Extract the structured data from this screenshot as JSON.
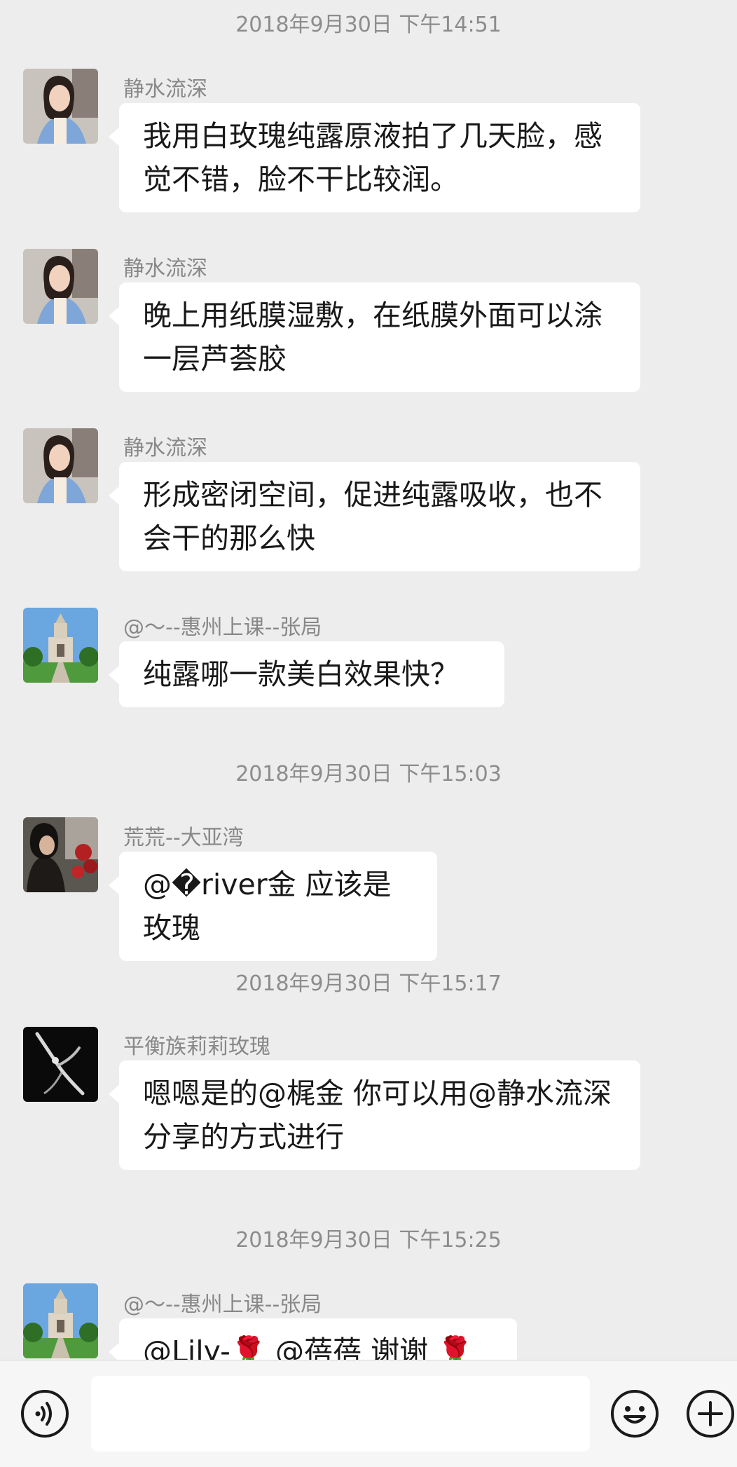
{
  "timestamps": [
    "2018年9月30日 下午14:51",
    "2018年9月30日 下午15:03",
    "2018年9月30日 下午15:17",
    "2018年9月30日 下午15:25"
  ],
  "messages": [
    {
      "sender": "静水流深",
      "text": "我用白玫瑰纯露原液拍了几天脸，感觉不错，脸不干比较润。",
      "avatar": "woman-portrait-avatar"
    },
    {
      "sender": "静水流深",
      "text": "晚上用纸膜湿敷，在纸膜外面可以涂一层芦荟胶",
      "avatar": "woman-portrait-avatar"
    },
    {
      "sender": "静水流深",
      "text": "形成密闭空间，促进纯露吸收，也不会干的那么快",
      "avatar": "woman-portrait-avatar"
    },
    {
      "sender": "@～--惠州上课--张局",
      "text": "纯露哪一款美白效果快？",
      "avatar": "building-avatar"
    },
    {
      "sender": "荒荒--大亚湾",
      "text": "@�river金  应该是玫瑰",
      "avatar": "woman-roses-avatar"
    },
    {
      "sender": "平衡族莉莉玫瑰",
      "text": "嗯嗯是的@梶金 你可以用@静水流深 分享的方式进行",
      "avatar": "dancer-avatar"
    },
    {
      "sender": "@～--惠州上课--张局",
      "text": "@Lily-🌹 @蓓蓓 谢谢 🌹",
      "avatar": "building-avatar"
    }
  ],
  "input": {
    "value": "",
    "placeholder": ""
  },
  "icons": {
    "voice": "voice-icon",
    "emoji": "emoji-icon",
    "plus": "plus-icon"
  },
  "colors": {
    "background": "#ededed",
    "bubble": "#ffffff",
    "bar": "#f6f6f6"
  }
}
